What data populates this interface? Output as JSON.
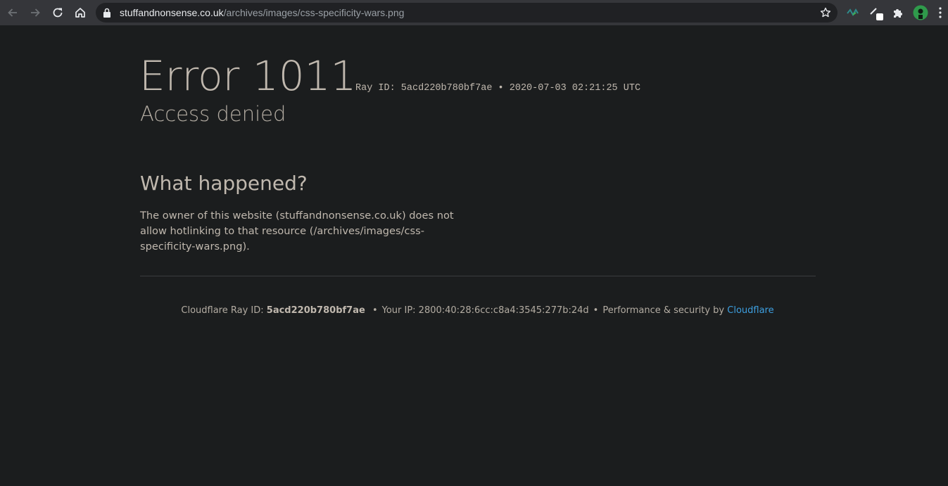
{
  "browser": {
    "url_host": "stuffandnonsense.co.uk",
    "url_path": "/archives/images/css-specificity-wars.png"
  },
  "error": {
    "title": "Error 1011",
    "ray_header": "Ray ID: 5acd220b780bf7ae • 2020-07-03 02:21:25 UTC",
    "subtitle": "Access denied"
  },
  "section": {
    "heading": "What happened?",
    "description": "The owner of this website (stuffandnonsense.co.uk) does not allow hotlinking to that resource (/archives/images/css-specificity-wars.png)."
  },
  "footer": {
    "ray_label": "Cloudflare Ray ID:",
    "ray_id": "5acd220b780bf7ae",
    "separator": "•",
    "ip_text": "Your IP: 2800:40:28:6cc:c8a4:3545:277b:24d",
    "perf_text": "Performance & security by",
    "link_text": "Cloudflare"
  },
  "colors": {
    "background": "#1b1d1e",
    "text": "#c0b8ae",
    "link": "#3d9fe0",
    "toolbar": "#35363a"
  },
  "icons": [
    "back-icon",
    "forward-icon",
    "reload-icon",
    "home-icon",
    "lock-icon",
    "star-icon",
    "extension-wave-icon",
    "extension-pen-icon",
    "puzzle-icon",
    "profile-avatar",
    "kebab-menu-icon"
  ]
}
